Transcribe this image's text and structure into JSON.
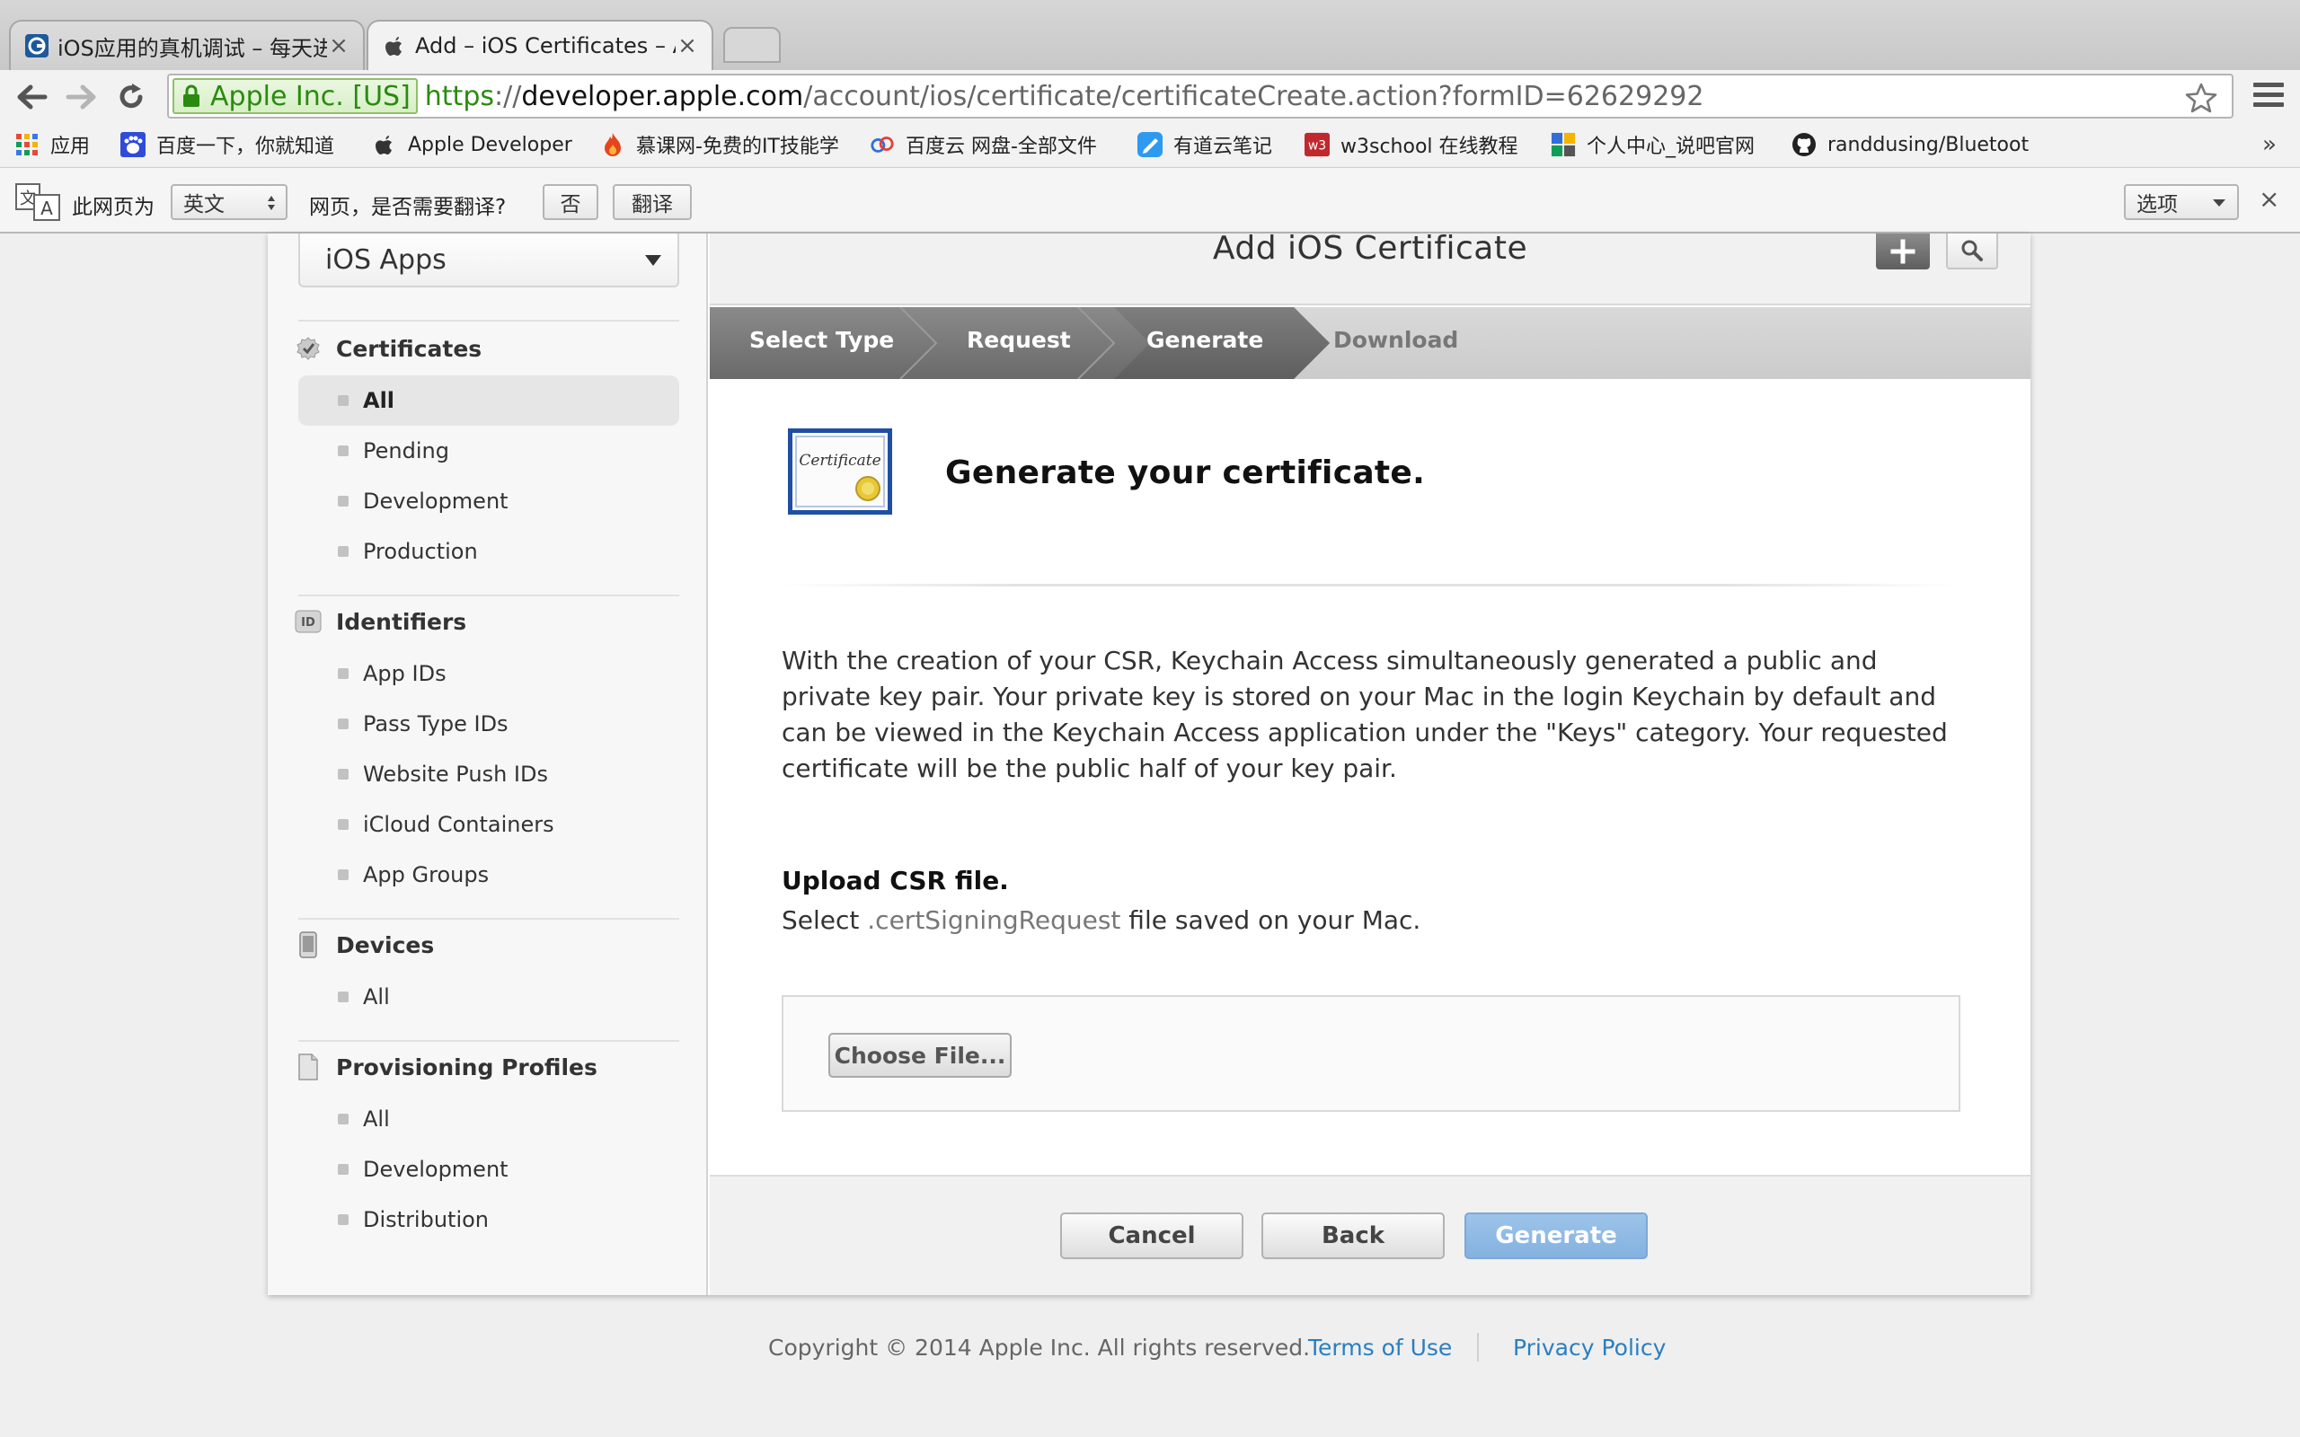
{
  "browser": {
    "tabs": [
      {
        "title": "iOS应用的真机调试 – 每天进",
        "active": false
      },
      {
        "title": "Add – iOS Certificates – Ap",
        "active": true
      }
    ],
    "ev_label": "Apple Inc. [US]",
    "url": {
      "scheme": "https",
      "sep": "://",
      "host": "developer.apple.com",
      "path": "/account/ios/certificate/certificateCreate.action?formID=62629292"
    },
    "bookmarks": [
      {
        "label": "应用",
        "icon": "apps-grid-icon"
      },
      {
        "label": "百度一下，你就知道",
        "icon": "baidu-paw-icon"
      },
      {
        "label": "Apple Developer",
        "icon": "apple-logo-icon"
      },
      {
        "label": "慕课网-免费的IT技能学",
        "icon": "flame-icon"
      },
      {
        "label": "百度云 网盘-全部文件",
        "icon": "cloud-icon"
      },
      {
        "label": "有道云笔记",
        "icon": "note-icon"
      },
      {
        "label": "w3school 在线教程",
        "icon": "w3-icon"
      },
      {
        "label": "个人中心_说吧官网",
        "icon": "user-center-icon"
      },
      {
        "label": "randdusing/Bluetoot",
        "icon": "github-icon"
      }
    ],
    "translate_bar": {
      "prefix": "此网页为",
      "language": "英文",
      "question": "网页，是否需要翻译?",
      "no_label": "否",
      "translate_label": "翻译",
      "options_label": "选项"
    }
  },
  "sidebar": {
    "platform": "iOS Apps",
    "sections": [
      {
        "title": "Certificates",
        "icon": "certificate-seal-icon",
        "items": [
          "All",
          "Pending",
          "Development",
          "Production"
        ],
        "selected": 0
      },
      {
        "title": "Identifiers",
        "icon": "id-badge-icon",
        "items": [
          "App IDs",
          "Pass Type IDs",
          "Website Push IDs",
          "iCloud Containers",
          "App Groups"
        ]
      },
      {
        "title": "Devices",
        "icon": "device-icon",
        "items": [
          "All"
        ]
      },
      {
        "title": "Provisioning Profiles",
        "icon": "document-icon",
        "items": [
          "All",
          "Development",
          "Distribution"
        ]
      }
    ]
  },
  "header": {
    "title": "Add iOS Certificate"
  },
  "steps": [
    "Select Type",
    "Request",
    "Generate",
    "Download"
  ],
  "content": {
    "heading": "Generate your certificate.",
    "certificate_icon_text": "Certificate",
    "description": "With the creation of your CSR, Keychain Access simultaneously generated a public and private key pair. Your private key is stored on your Mac in the login Keychain by default and can be viewed in the Keychain Access application under the \"Keys\" category. Your requested certificate will be the public half of your key pair.",
    "upload_heading": "Upload CSR file.",
    "upload_sub_before": "Select ",
    "upload_sub_ext": ".certSigningRequest",
    "upload_sub_after": " file saved on your Mac.",
    "choose_file": "Choose File..."
  },
  "buttons": {
    "cancel": "Cancel",
    "back": "Back",
    "generate": "Generate"
  },
  "footer": {
    "copyright": "Copyright © 2014 Apple Inc. All rights reserved.",
    "terms": "Terms of Use",
    "privacy": "Privacy Policy"
  },
  "colors": {
    "link": "#2a7fc0",
    "ev_green": "#2b8a10",
    "generate_blue": "#8ab6e3",
    "step_dark": "#6e6e6e"
  }
}
